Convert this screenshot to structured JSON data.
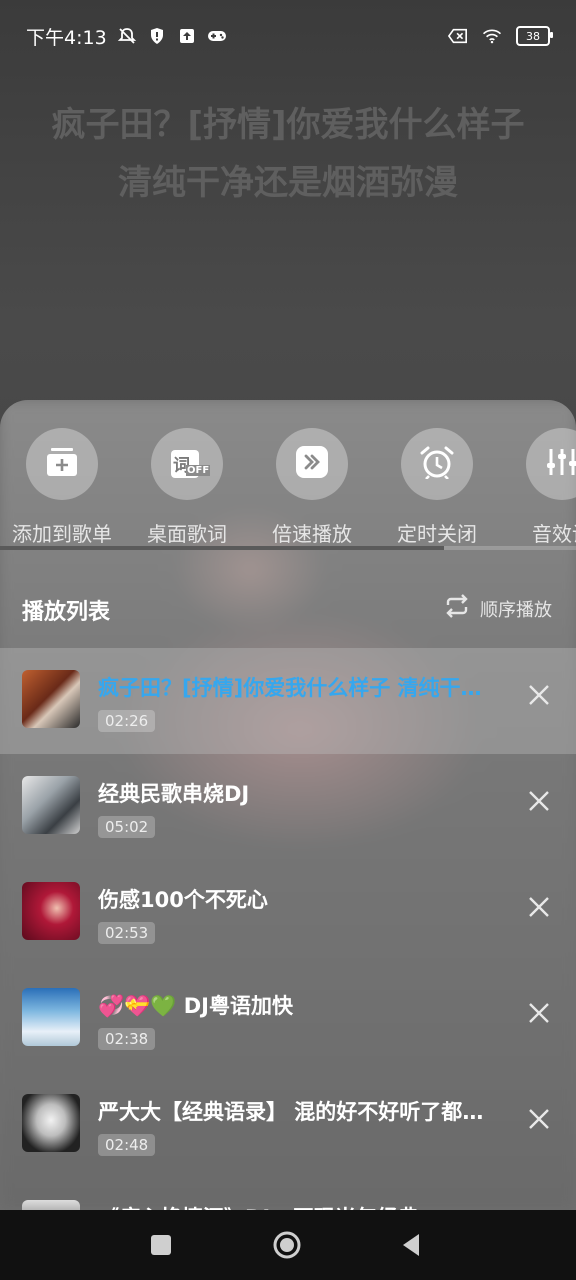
{
  "status_bar": {
    "time": "下午4:13",
    "battery": "38"
  },
  "lyrics": {
    "line1": "疯子田？[抒情]你爱我什么样子",
    "line2": "清纯干净还是烟酒弥漫"
  },
  "tools": [
    {
      "label": "添加到歌单",
      "icon": "add-to-playlist-icon"
    },
    {
      "label": "桌面歌词",
      "icon": "desktop-lyrics-off-icon",
      "badge": "OFF",
      "glyph": "词"
    },
    {
      "label": "倍速播放",
      "icon": "playback-speed-icon"
    },
    {
      "label": "定时关闭",
      "icon": "alarm-clock-icon"
    },
    {
      "label": "音效设",
      "icon": "equalizer-icon"
    }
  ],
  "playlist": {
    "title": "播放列表",
    "order_label": "顺序播放",
    "items": [
      {
        "title": "疯子田？[抒情]你爱我什么样子 清纯干净还是烟酒弥漫",
        "duration": "02:26",
        "active": true
      },
      {
        "title": "经典民歌串烧DJ",
        "duration": "05:02"
      },
      {
        "title": "伤感100个不死心",
        "duration": "02:53"
      },
      {
        "title": "💞💝💚 DJ粤语加快",
        "duration": "02:38"
      },
      {
        "title": "严大大【经典语录】 混的好不好听了都流泪",
        "duration": "02:48"
      },
      {
        "title": "《痴心换情深》DJ · 再现当年经典",
        "duration": ""
      }
    ]
  },
  "colors": {
    "active_title": "#36a7ee",
    "sheet_bg": "#747474"
  }
}
